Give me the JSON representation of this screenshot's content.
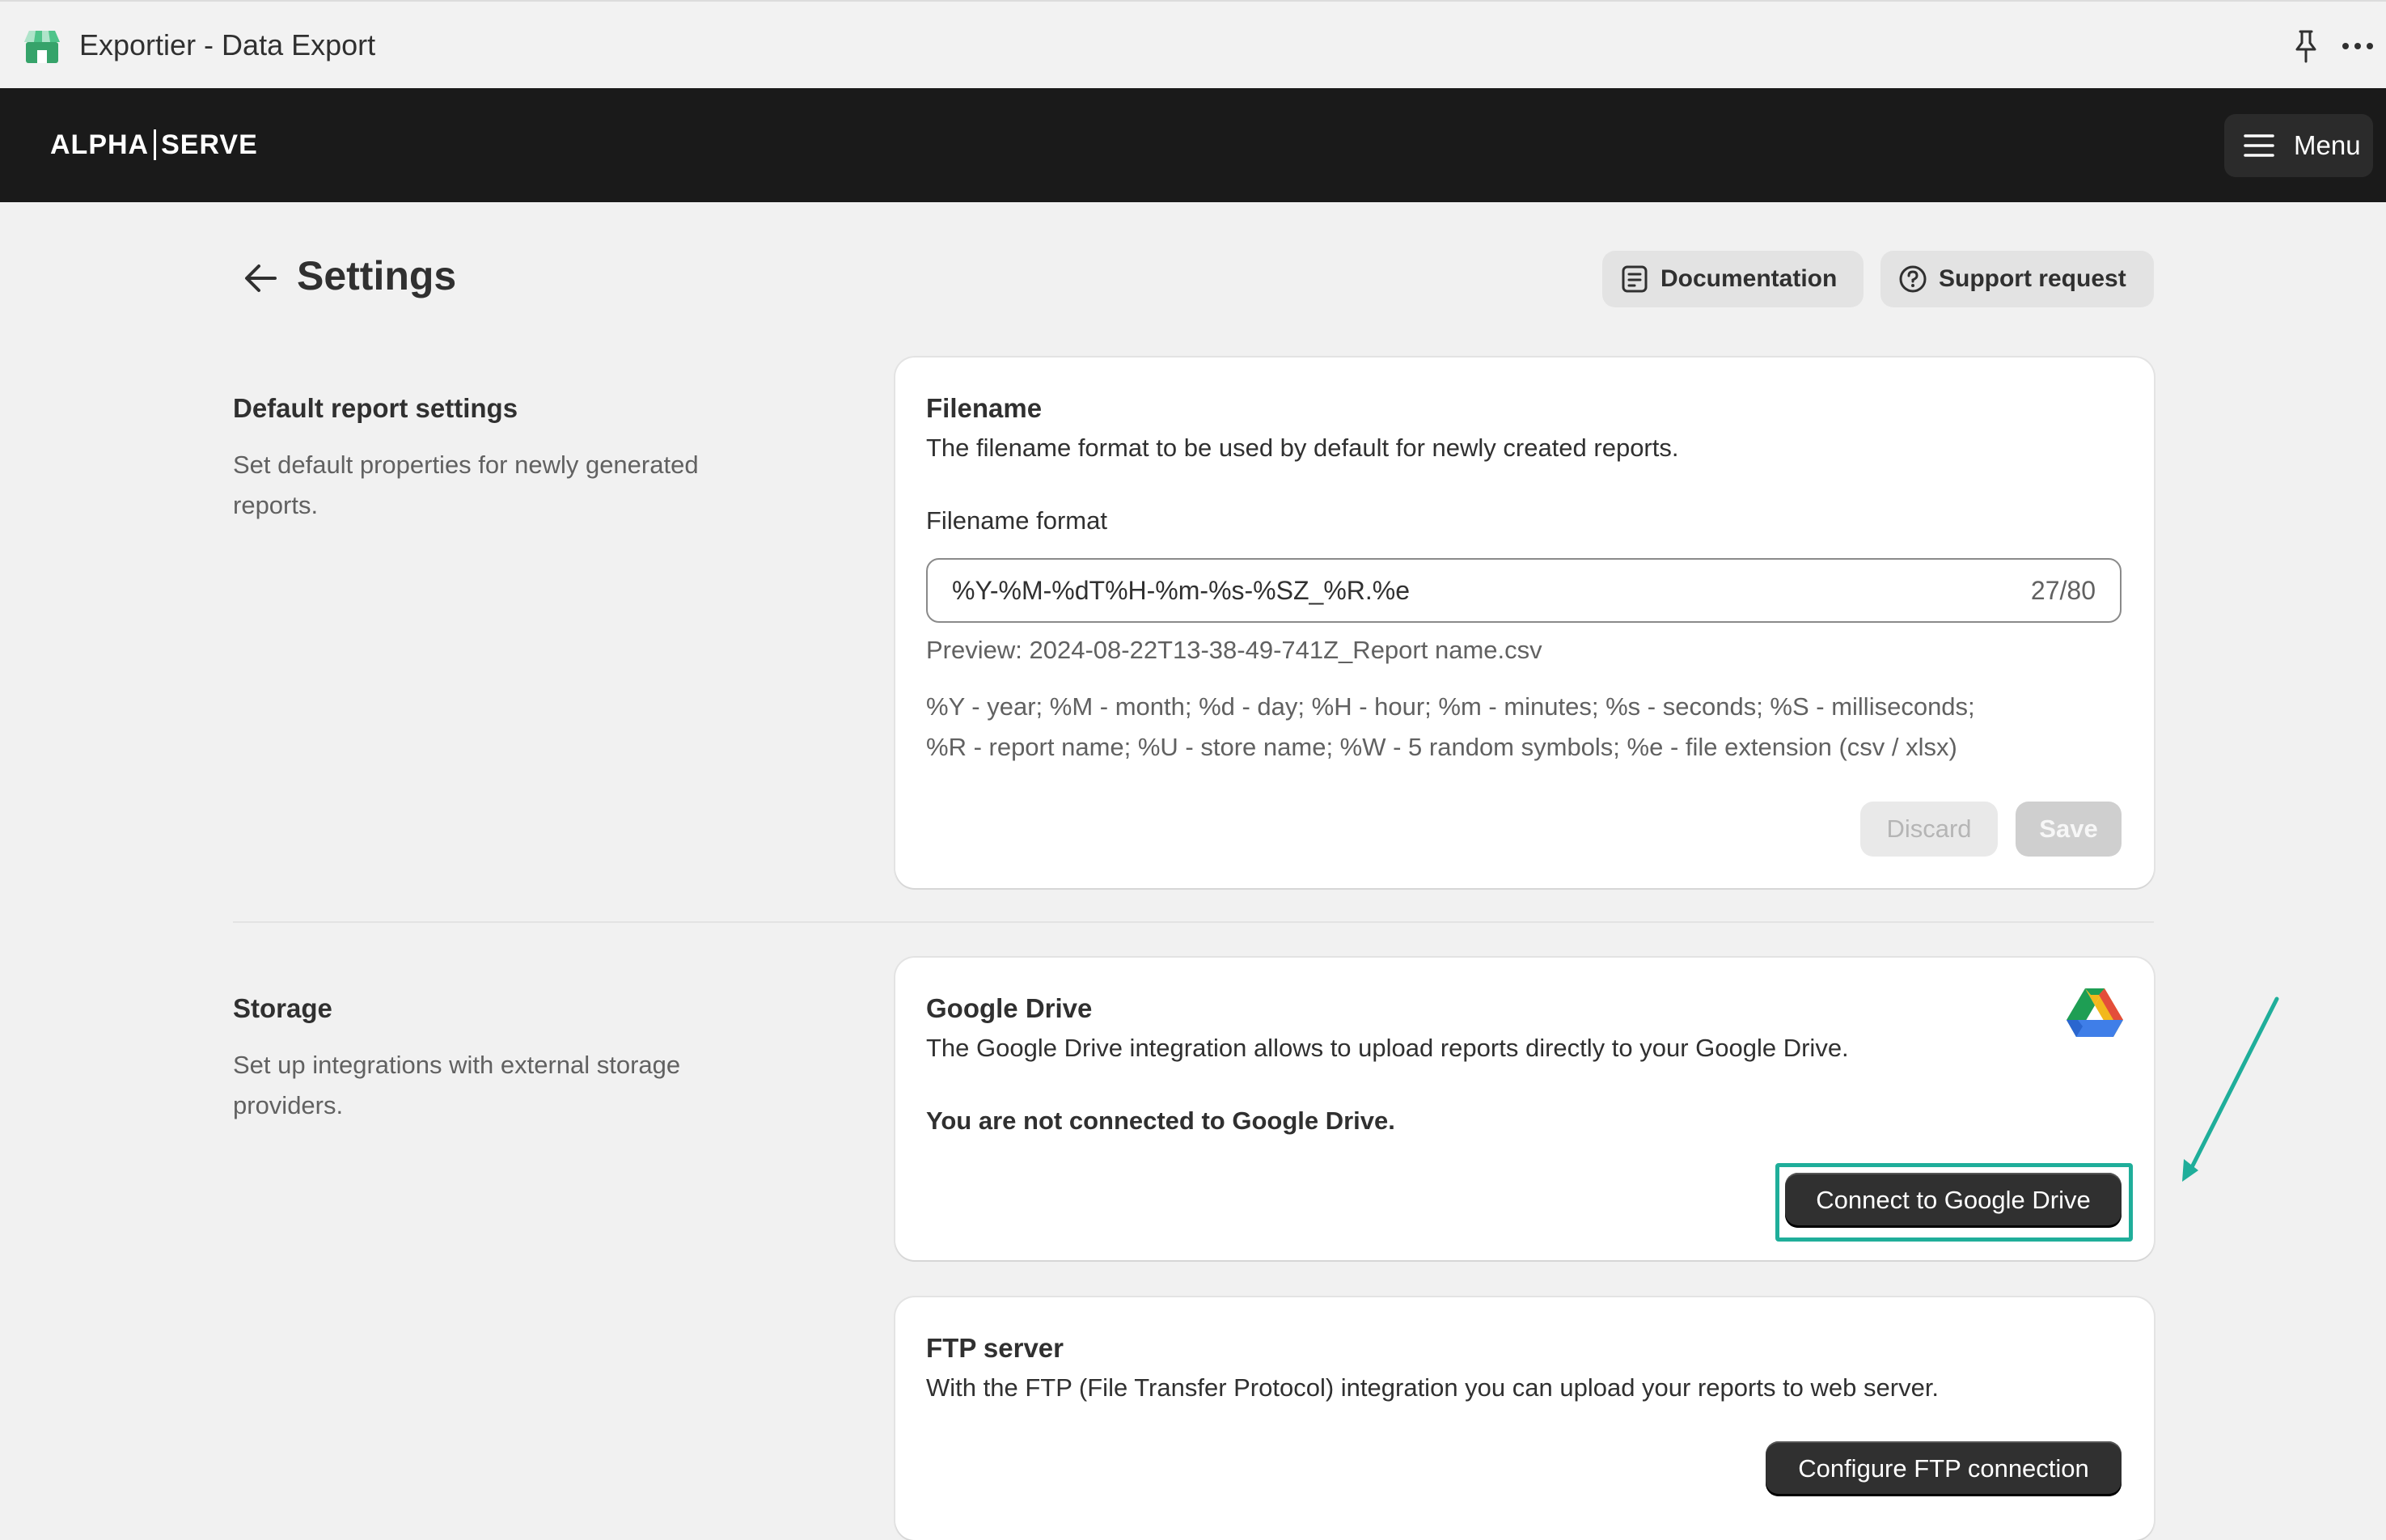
{
  "window": {
    "title": "Exportier - Data Export"
  },
  "header": {
    "logo_left": "ALPHA",
    "logo_right": "SERVE",
    "menu_label": "Menu"
  },
  "page": {
    "title": "Settings",
    "documentation_label": "Documentation",
    "support_label": "Support request"
  },
  "default_report": {
    "section_title": "Default report settings",
    "section_desc": "Set default properties for newly generated reports.",
    "card_title": "Filename",
    "card_desc": "The filename format to be used by default for newly created reports.",
    "field_label": "Filename format",
    "field_value": "%Y-%M-%dT%H-%m-%s-%SZ_%R.%e",
    "char_count": "27/80",
    "preview": "Preview: 2024-08-22T13-38-49-741Z_Report name.csv",
    "legend_line1": "%Y - year; %M - month; %d - day; %H - hour; %m - minutes; %s - seconds; %S - milliseconds;",
    "legend_line2": "%R - report name; %U - store name; %W - 5 random symbols; %e - file extension (csv / xlsx)",
    "discard_label": "Discard",
    "save_label": "Save"
  },
  "storage": {
    "section_title": "Storage",
    "section_desc": "Set up integrations with external storage providers.",
    "gdrive": {
      "title": "Google Drive",
      "desc": "The Google Drive integration allows to upload reports directly to your Google Drive.",
      "status": "You are not connected to Google Drive.",
      "connect_label": "Connect to Google Drive",
      "icon": "google-drive-icon"
    },
    "ftp": {
      "title": "FTP server",
      "desc": "With the FTP (File Transfer Protocol) integration you can upload your reports to web server.",
      "configure_label": "Configure FTP connection"
    }
  },
  "colors": {
    "header_bg": "#1a1a1a",
    "accent_highlight": "#1fae9a",
    "primary_button": "#303030"
  }
}
